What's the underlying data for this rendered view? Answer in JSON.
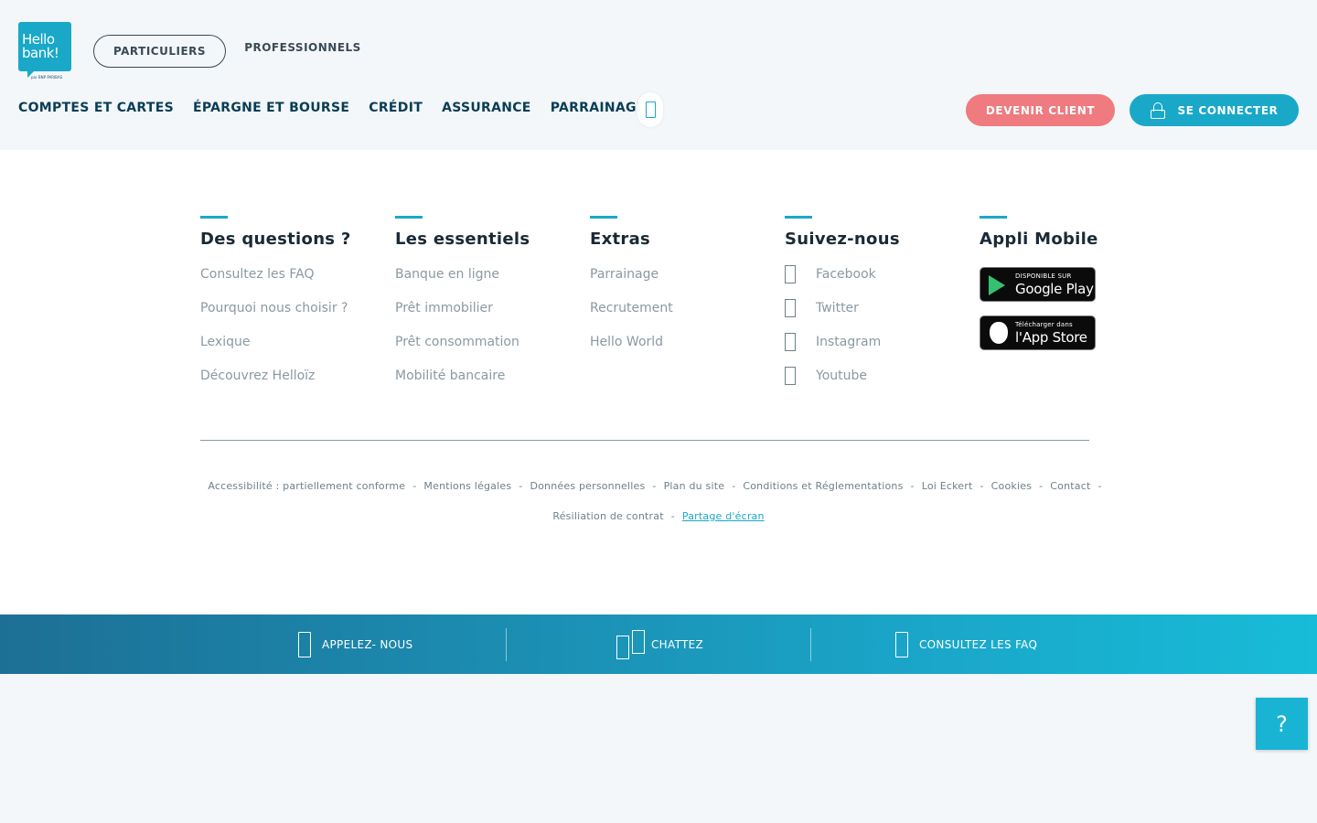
{
  "brand": {
    "line1": "Hello",
    "line2": "bank!",
    "tagline": "par BNP PARIBAS",
    "color": "#19a8c8"
  },
  "segments": {
    "particuliers": "PARTICULIERS",
    "professionnels": "PROFESSIONNELS"
  },
  "nav": {
    "items": [
      "COMPTES ET CARTES",
      "ÉPARGNE ET BOURSE",
      "CRÉDIT",
      "ASSURANCE",
      "PARRAINAGE"
    ],
    "search_icon": "search-icon"
  },
  "actions": {
    "devenir_client": "DEVENIR CLIENT",
    "se_connecter": "SE CONNECTER",
    "client_color": "#ef7a7f"
  },
  "footer": {
    "columns": [
      {
        "title": "Des questions ?",
        "links": [
          "Consultez les FAQ",
          "Pourquoi nous choisir ?",
          "Lexique",
          "Découvrez Helloïz"
        ]
      },
      {
        "title": "Les essentiels",
        "links": [
          "Banque en ligne",
          "Prêt immobilier",
          "Prêt consommation",
          "Mobilité bancaire"
        ]
      },
      {
        "title": "Extras",
        "links": [
          "Parrainage",
          "Recrutement",
          "Hello World"
        ]
      },
      {
        "title": "Suivez-nous",
        "links": [
          "Facebook",
          "Twitter",
          "Instagram",
          "Youtube"
        ]
      },
      {
        "title": "Appli Mobile"
      }
    ],
    "stores": {
      "google_small": "DISPONIBLE SUR",
      "google_big": "Google Play",
      "apple_small": "Télécharger dans",
      "apple_big": "l'App Store"
    },
    "legal_line1": [
      "Accessibilité : partiellement conforme",
      "Mentions légales",
      "Données personnelles",
      "Plan du site",
      "Conditions et Réglementations",
      "Loi Eckert",
      "Cookies",
      "Contact"
    ],
    "legal_line2": [
      "Résiliation de contrat",
      "Partage d'écran"
    ],
    "separator": "-"
  },
  "contact_band": {
    "call": "APPELEZ- NOUS",
    "chat": "CHATTEZ",
    "faq": "CONSULTEZ LES FAQ"
  },
  "help_button": "?"
}
